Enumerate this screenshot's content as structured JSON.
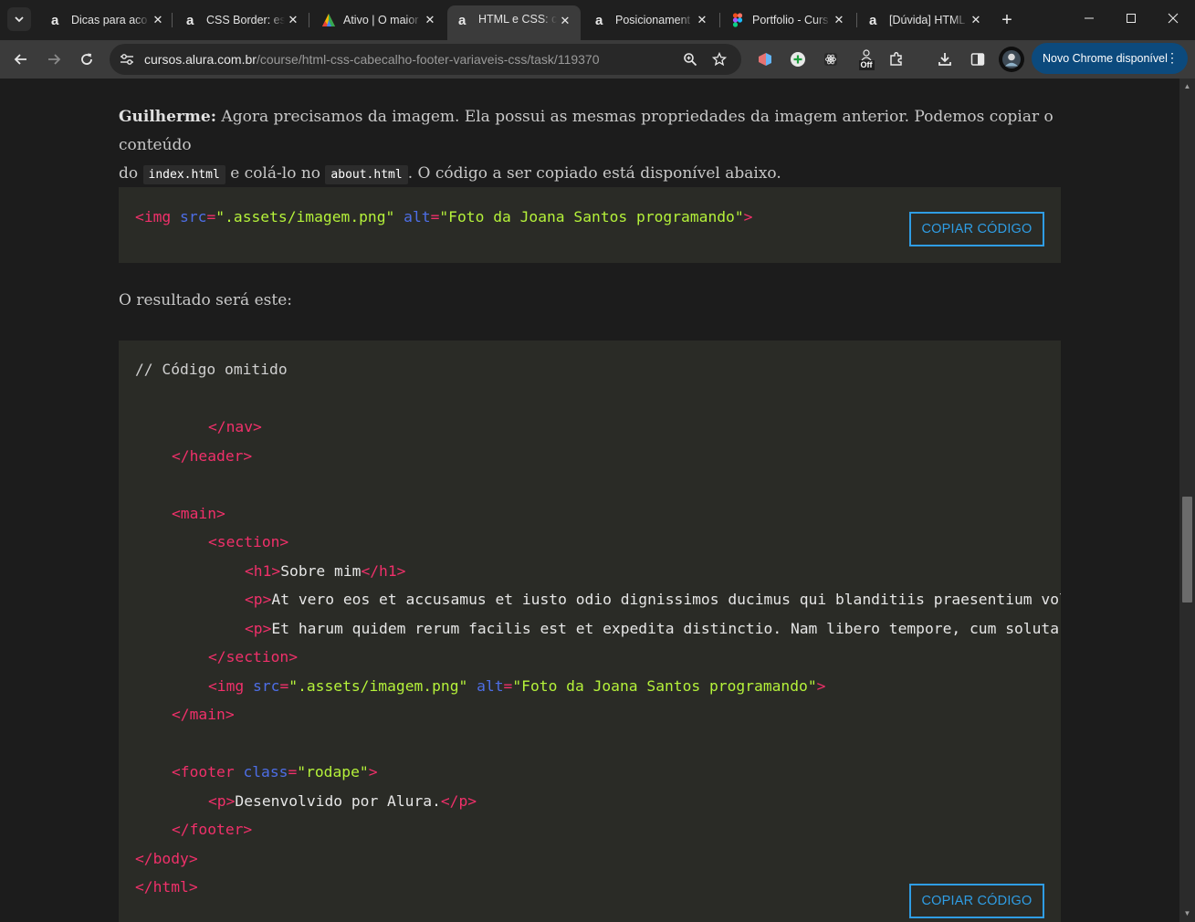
{
  "tabs": [
    {
      "title": "Dicas para aco",
      "favicon": "alura-icon"
    },
    {
      "title": "CSS Border: est",
      "favicon": "alura-icon"
    },
    {
      "title": "Ativo | O maior",
      "favicon": "colorful-triangle-icon"
    },
    {
      "title": "HTML e CSS: ca",
      "favicon": "alura-icon",
      "active": true
    },
    {
      "title": "Posicionament",
      "favicon": "alura-icon"
    },
    {
      "title": "Portfolio - Curs",
      "favicon": "figma-icon"
    },
    {
      "title": "[Dúvida] HTML",
      "favicon": "alura-icon"
    }
  ],
  "address_bar": {
    "host": "cursos.alura.com.br",
    "path": "/course/html-css-cabecalho-footer-variaveis-css/task/119370"
  },
  "update_chip": "Novo Chrome disponível",
  "extension_badge": "Off",
  "content": {
    "intro": {
      "speaker": "Guilherme:",
      "part1": " Agora precisamos da imagem. Ela possui as mesmas propriedades da imagem anterior. Podemos copiar o conteúdo",
      "part2_pre": "do ",
      "code1": "index.html",
      "part2_mid": " e colá-lo no ",
      "code2": "about.html",
      "part2_post": ". O código a ser copiado está disponível abaixo."
    },
    "code1": {
      "lt": "<",
      "tag": "img",
      "attr1": "src",
      "val1": "\".assets/imagem.png\"",
      "attr2": "alt",
      "val2": "\"Foto da Joana Santos programando\"",
      "gt": ">"
    },
    "copy_button": "COPIAR CÓDIGO",
    "result_label": "O resultado será este:",
    "code2": {
      "comment": "// Código omitido",
      "nav_close": "</nav>",
      "header_close": "</header>",
      "main_open": "<main>",
      "section_open": "<section>",
      "h1_open": "<h1>",
      "h1_text": "Sobre mim",
      "h1_close": "</h1>",
      "p_open": "<p>",
      "p1_text": "At vero eos et accusamus et iusto odio dignissimos ducimus qui blanditiis praesentium voluptatum deleniti atque corrupti",
      "p2_text": "Et harum quidem rerum facilis est et expedita distinctio. Nam libero tempore, cum soluta nobis est eligendi optio cumque",
      "section_close": "</section>",
      "img_lt": "<img",
      "img_src_attr": "src",
      "img_src_val": "\".assets/imagem.png\"",
      "img_alt_attr": "alt",
      "img_alt_val": "\"Foto da Joana Santos programando\"",
      "img_gt": ">",
      "main_close": "</main>",
      "footer_open_lt": "<footer",
      "footer_class_attr": "class",
      "footer_class_val": "\"rodape\"",
      "footer_open_gt": ">",
      "p3_text": "Desenvolvido por Alura.",
      "p_close": "</p>",
      "footer_close": "</footer>",
      "body_close": "</body>",
      "html_close": "</html>",
      "eq": "="
    }
  }
}
